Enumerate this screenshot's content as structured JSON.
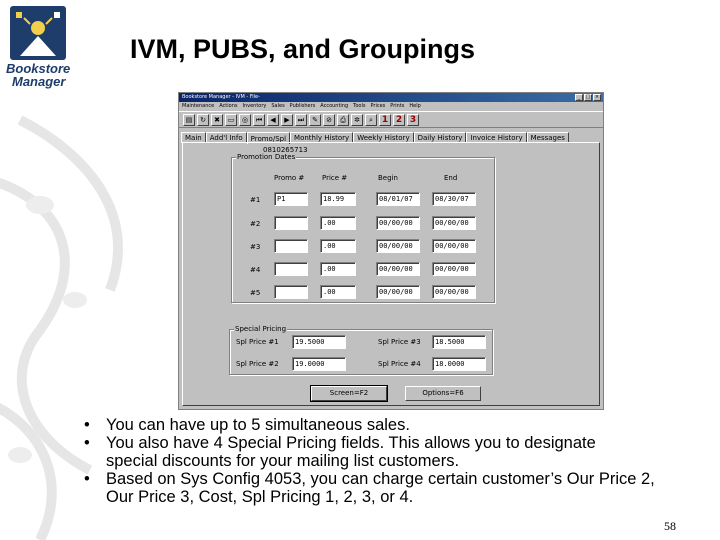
{
  "slide": {
    "title": "IVM, PUBS, and Groupings",
    "page_number": "58",
    "logo": {
      "line1": "Bookstore",
      "line2": "Manager"
    }
  },
  "window": {
    "title": "Bookstore Manager - IVM - File-",
    "menu": [
      "Maintenance",
      "Actions",
      "Inventory",
      "Sales",
      "Publishers",
      "Accounting",
      "Tools",
      "Prices",
      "Prints",
      "Help"
    ],
    "tabs": [
      "Main",
      "Add'l Info",
      "Promo/Spl",
      "Monthly History",
      "Weekly History",
      "Daily History",
      "Invoice History",
      "Messages"
    ],
    "active_tab": "Promo/Spl",
    "isbn": "0810265713",
    "promotion": {
      "group_label": "Promotion Dates",
      "headers": {
        "promo": "Promo #",
        "price": "Price #",
        "begin": "Begin",
        "end": "End"
      },
      "rows": [
        {
          "label": "#1",
          "promo": "P1",
          "price": "18.99",
          "begin": "08/01/07",
          "end": "08/30/07"
        },
        {
          "label": "#2",
          "promo": "",
          "price": ".00",
          "begin": "00/00/00",
          "end": "00/00/00"
        },
        {
          "label": "#3",
          "promo": "",
          "price": ".00",
          "begin": "00/00/00",
          "end": "00/00/00"
        },
        {
          "label": "#4",
          "promo": "",
          "price": ".00",
          "begin": "00/00/00",
          "end": "00/00/00"
        },
        {
          "label": "#5",
          "promo": "",
          "price": ".00",
          "begin": "00/00/00",
          "end": "00/00/00"
        }
      ]
    },
    "special": {
      "group_label": "Special Pricing",
      "fields": [
        {
          "label": "Spl Price #1",
          "value": "19.5000"
        },
        {
          "label": "Spl Price #2",
          "value": "19.0000"
        },
        {
          "label": "Spl Price #3",
          "value": "18.5000"
        },
        {
          "label": "Spl Price #4",
          "value": "18.0000"
        }
      ]
    },
    "buttons": {
      "screen": "Screen=F2",
      "options": "Options=F6"
    }
  },
  "bullets": [
    "You can have up to 5 simultaneous sales.",
    "You also have 4 Special Pricing fields.  This allows you to designate special discounts for your mailing list customers.",
    "Based on Sys Config 4053, you can charge certain customer’s Our Price 2, Our Price 3, Cost, Spl Pricing 1, 2, 3, or 4."
  ]
}
